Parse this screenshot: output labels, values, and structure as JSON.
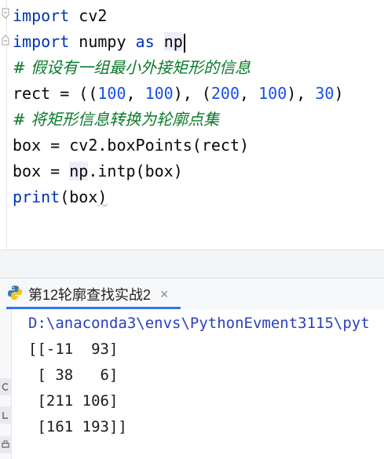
{
  "editor": {
    "lines": [
      {
        "parts": [
          {
            "t": "import",
            "c": "kw"
          },
          {
            "t": " cv2",
            "c": ""
          }
        ]
      },
      {
        "parts": [
          {
            "t": "import",
            "c": "kw"
          },
          {
            "t": " numpy ",
            "c": ""
          },
          {
            "t": "as",
            "c": "kw"
          },
          {
            "t": " ",
            "c": ""
          },
          {
            "t": "np",
            "c": "np"
          }
        ]
      },
      {
        "parts": [
          {
            "t": "# 假设有一组最小外接矩形的信息",
            "c": "cmt"
          }
        ]
      },
      {
        "parts": [
          {
            "t": "rect = ((",
            "c": ""
          },
          {
            "t": "100",
            "c": "num"
          },
          {
            "t": ", ",
            "c": ""
          },
          {
            "t": "100",
            "c": "num"
          },
          {
            "t": "), (",
            "c": ""
          },
          {
            "t": "200",
            "c": "num"
          },
          {
            "t": ", ",
            "c": ""
          },
          {
            "t": "100",
            "c": "num"
          },
          {
            "t": "), ",
            "c": ""
          },
          {
            "t": "30",
            "c": "num"
          },
          {
            "t": ")",
            "c": ""
          }
        ]
      },
      {
        "parts": [
          {
            "t": "# 将矩形信息转换为轮廓点集",
            "c": "cmt"
          }
        ]
      },
      {
        "parts": [
          {
            "t": "box = cv2.boxPoints(rect)",
            "c": ""
          }
        ]
      },
      {
        "parts": [
          {
            "t": "box = ",
            "c": ""
          },
          {
            "t": "np",
            "c": "np"
          },
          {
            "t": ".intp(box)",
            "c": ""
          }
        ]
      },
      {
        "parts": [
          {
            "t": "print",
            "c": "kw"
          },
          {
            "t": "(box",
            "c": ""
          },
          {
            "t": ")",
            "c": "sq"
          }
        ]
      }
    ]
  },
  "run": {
    "tab_label": "第12轮廓查找实战2",
    "close_symbol": "×"
  },
  "console": {
    "path": "D:\\anaconda3\\envs\\PythonEvment3115\\pyt",
    "output": [
      "[[-11  93]",
      " [ 38   6]",
      " [211 106]",
      " [161 193]]"
    ]
  }
}
